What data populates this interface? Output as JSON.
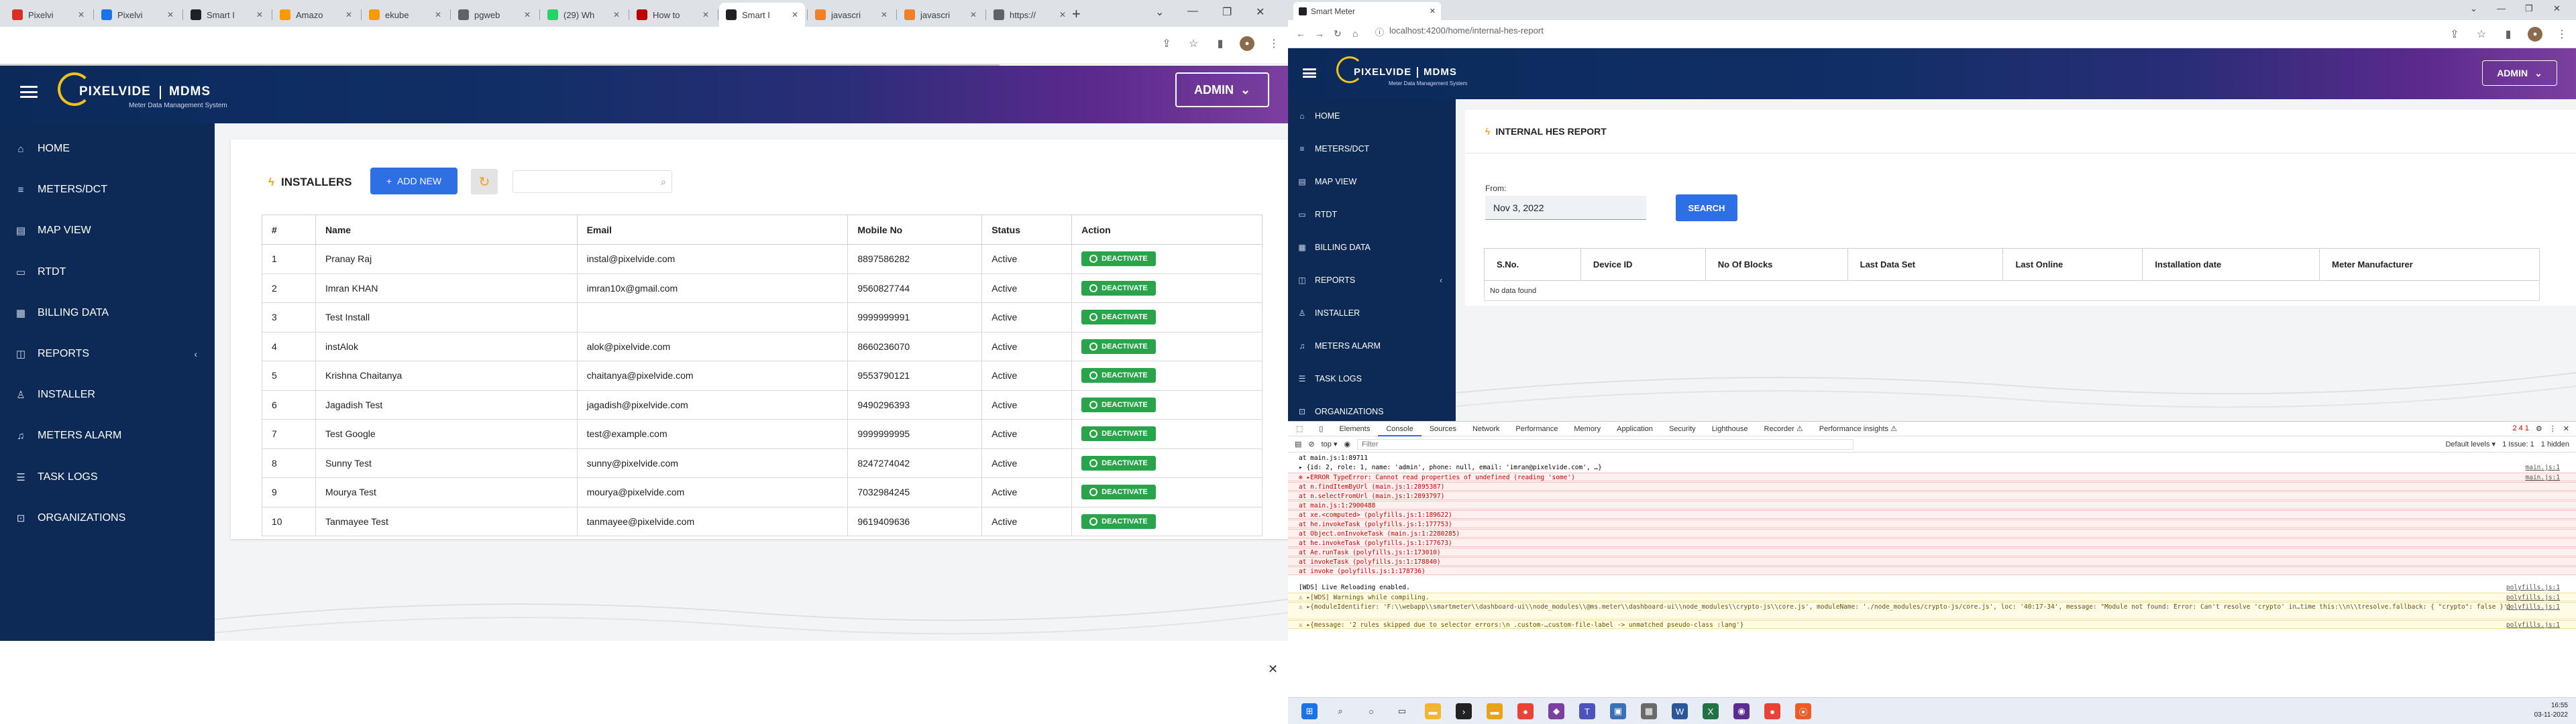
{
  "left": {
    "tabs": [
      {
        "label": "Pixelvi",
        "color": "#d93025"
      },
      {
        "label": "Pixelvi",
        "color": "#1a73e8"
      },
      {
        "label": "Smart I",
        "color": "#202124"
      },
      {
        "label": "Amazo",
        "color": "#ff9900"
      },
      {
        "label": "ekube",
        "color": "#ff9900"
      },
      {
        "label": "pgweb",
        "color": "#5f6368"
      },
      {
        "label": "(29) Wh",
        "color": "#25d366"
      },
      {
        "label": "How to",
        "color": "#c00000"
      },
      {
        "label": "Smart I",
        "color": "#202124"
      },
      {
        "label": "javascri",
        "color": "#f48024"
      },
      {
        "label": "javascri",
        "color": "#f48024"
      },
      {
        "label": "https://",
        "color": "#5f6368"
      }
    ],
    "brand": {
      "name": "PIXELVIDE",
      "product": "MDMS",
      "subtitle": "Meter Data Management System"
    },
    "admin_label": "ADMIN",
    "nav": [
      {
        "label": "HOME",
        "icon": "home-icon"
      },
      {
        "label": "METERS/DCT",
        "icon": "list-icon"
      },
      {
        "label": "MAP VIEW",
        "icon": "map-icon"
      },
      {
        "label": "RTDT",
        "icon": "document-icon"
      },
      {
        "label": "BILLING DATA",
        "icon": "grid-icon"
      },
      {
        "label": "REPORTS",
        "icon": "report-icon",
        "chevron": "‹"
      },
      {
        "label": "INSTALLER",
        "icon": "user-icon"
      },
      {
        "label": "METERS ALARM",
        "icon": "bell-icon"
      },
      {
        "label": "TASK LOGS",
        "icon": "log-icon"
      },
      {
        "label": "ORGANIZATIONS",
        "icon": "org-icon"
      }
    ],
    "page": {
      "title": "INSTALLERS",
      "add_button": "ADD NEW",
      "search_placeholder": "",
      "columns": [
        "#",
        "Name",
        "Email",
        "Mobile No",
        "Status",
        "Action"
      ],
      "rows": [
        {
          "n": "1",
          "name": "Pranay Raj",
          "email": "instal@pixelvide.com",
          "mobile": "8897586282",
          "status": "Active",
          "action": "DEACTIVATE"
        },
        {
          "n": "2",
          "name": "Imran KHAN",
          "email": "imran10x@gmail.com",
          "mobile": "9560827744",
          "status": "Active",
          "action": "DEACTIVATE"
        },
        {
          "n": "3",
          "name": "Test Install",
          "email": "",
          "mobile": "9999999991",
          "status": "Active",
          "action": "DEACTIVATE"
        },
        {
          "n": "4",
          "name": "instAlok",
          "email": "alok@pixelvide.com",
          "mobile": "8660236070",
          "status": "Active",
          "action": "DEACTIVATE"
        },
        {
          "n": "5",
          "name": "Krishna Chaitanya",
          "email": "chaitanya@pixelvide.com",
          "mobile": "9553790121",
          "status": "Active",
          "action": "DEACTIVATE"
        },
        {
          "n": "6",
          "name": "Jagadish Test",
          "email": "jagadish@pixelvide.com",
          "mobile": "9490296393",
          "status": "Active",
          "action": "DEACTIVATE"
        },
        {
          "n": "7",
          "name": "Test Google",
          "email": "test@example.com",
          "mobile": "9999999995",
          "status": "Active",
          "action": "DEACTIVATE"
        },
        {
          "n": "8",
          "name": "Sunny Test",
          "email": "sunny@pixelvide.com",
          "mobile": "8247274042",
          "status": "Active",
          "action": "DEACTIVATE"
        },
        {
          "n": "9",
          "name": "Mourya Test",
          "email": "mourya@pixelvide.com",
          "mobile": "7032984245",
          "status": "Active",
          "action": "DEACTIVATE"
        },
        {
          "n": "10",
          "name": "Tanmayee Test",
          "email": "tanmayee@pixelvide.com",
          "mobile": "9619409636",
          "status": "Active",
          "action": "DEACTIVATE"
        }
      ]
    }
  },
  "right": {
    "tab_title": "Smart Meter",
    "url": "localhost:4200/home/internal-hes-report",
    "brand": {
      "name": "PIXELVIDE",
      "product": "MDMS",
      "subtitle": "Meter Data Management System"
    },
    "admin_label": "ADMIN",
    "nav": [
      {
        "label": "HOME",
        "icon": "home-icon"
      },
      {
        "label": "METERS/DCT",
        "icon": "list-icon"
      },
      {
        "label": "MAP VIEW",
        "icon": "map-icon"
      },
      {
        "label": "RTDT",
        "icon": "document-icon"
      },
      {
        "label": "BILLING DATA",
        "icon": "grid-icon"
      },
      {
        "label": "REPORTS",
        "icon": "report-icon",
        "chevron": "‹"
      },
      {
        "label": "INSTALLER",
        "icon": "user-icon"
      },
      {
        "label": "METERS ALARM",
        "icon": "bell-icon"
      },
      {
        "label": "TASK LOGS",
        "icon": "log-icon"
      },
      {
        "label": "ORGANIZATIONS",
        "icon": "org-icon"
      }
    ],
    "page": {
      "title": "INTERNAL HES REPORT",
      "from_label": "From:",
      "from_value": "Nov 3, 2022",
      "search_button": "SEARCH",
      "columns": [
        "S.No.",
        "Device ID",
        "No Of Blocks",
        "Last Data Set",
        "Last Online",
        "Installation date",
        "Meter Manufacturer"
      ],
      "empty_text": "No data found"
    },
    "devtools": {
      "tabs": [
        "Elements",
        "Console",
        "Sources",
        "Network",
        "Performance",
        "Memory",
        "Application",
        "Security",
        "Lighthouse",
        "Recorder ⚠",
        "Performance insights ⚠"
      ],
      "context": "top",
      "filter_placeholder": "Filter",
      "levels": "Default levels ▾",
      "issues": "1 Issue: 1",
      "hidden": "1 hidden",
      "counts": "2 4 1",
      "lines": [
        {
          "type": "log",
          "text": "    at main.js:1:89711",
          "src": ""
        },
        {
          "type": "log",
          "text": "▸ {id: 2, role: 1, name: 'admin', phone: null, email: 'imran@pixelvide.com', …}",
          "src": "main.js:1"
        },
        {
          "type": "err",
          "text": "⊗ ▸ERROR TypeError: Cannot read properties of undefined (reading 'some')",
          "src": "main.js:1"
        },
        {
          "type": "err",
          "text": "      at n.findItemByUrl (main.js:1:2895387)",
          "src": ""
        },
        {
          "type": "err",
          "text": "      at n.selectFromUrl (main.js:1:2893797)",
          "src": ""
        },
        {
          "type": "err",
          "text": "      at main.js:1:2900488",
          "src": ""
        },
        {
          "type": "err",
          "text": "      at xe.<computed> (polyfills.js:1:189622)",
          "src": ""
        },
        {
          "type": "err",
          "text": "      at he.invokeTask (polyfills.js:1:177753)",
          "src": ""
        },
        {
          "type": "err",
          "text": "      at Object.onInvokeTask (main.js:1:2280285)",
          "src": ""
        },
        {
          "type": "err",
          "text": "      at he.invokeTask (polyfills.js:1:177673)",
          "src": ""
        },
        {
          "type": "err",
          "text": "      at Ae.runTask (polyfills.js:1:173010)",
          "src": ""
        },
        {
          "type": "err",
          "text": "      at invokeTask (polyfills.js:1:178840)",
          "src": ""
        },
        {
          "type": "err",
          "text": "      at invoke (polyfills.js:1:178736)",
          "src": ""
        },
        {
          "type": "log",
          "text": "[WDS] Live Reloading enabled.",
          "src": "polyfills.js:1"
        },
        {
          "type": "warn",
          "text": "⚠ ▸[WDS] Warnings while compiling.",
          "src": "polyfills.js:1"
        },
        {
          "type": "warn",
          "text": "⚠ ▸{moduleIdentifier: 'F:\\\\webapp\\\\smartmeter\\\\dashboard-ui\\\\node_modules\\\\@ms.meter\\\\dashboard-ui\\\\node_modules\\\\crypto-js\\\\core.js', moduleName: './node_modules/crypto-js/core.js', loc: '40:17-34', message: \"Module not found: Error: Can't resolve 'crypto' in…time this:\\\\n\\\\tresolve.fallback: { \"crypto\": false }'}",
          "src": "polyfills.js:1"
        },
        {
          "type": "warn",
          "text": "⚠ ▸{message: '2 rules skipped due to selector errors:\\n  .custom-…custom-file-label -> unmatched pseudo-class :lang'}",
          "src": "polyfills.js:1"
        }
      ]
    }
  },
  "taskbar": {
    "time": "16:55",
    "date": "03-11-2022",
    "apps": [
      {
        "name": "windows-icon",
        "color": "#1a73e8",
        "glyph": "⊞"
      },
      {
        "name": "search-icon",
        "color": "#444",
        "glyph": "⌕"
      },
      {
        "name": "cortana-icon",
        "color": "#444",
        "glyph": "○"
      },
      {
        "name": "task-view-icon",
        "color": "#444",
        "glyph": "▭"
      },
      {
        "name": "file-explorer-icon",
        "color": "#f2b632",
        "glyph": "▬"
      },
      {
        "name": "terminal-icon",
        "color": "#222",
        "glyph": "›"
      },
      {
        "name": "folder-icon",
        "color": "#e8a317",
        "glyph": "▬"
      },
      {
        "name": "chrome-icon",
        "color": "#ea4335",
        "glyph": "●"
      },
      {
        "name": "visual-studio-icon",
        "color": "#7b3fa0",
        "glyph": "◆"
      },
      {
        "name": "teams-icon",
        "color": "#4b53bc",
        "glyph": "T"
      },
      {
        "name": "photos-icon",
        "color": "#3b6fb6",
        "glyph": "▣"
      },
      {
        "name": "app-icon-1",
        "color": "#6a6a6a",
        "glyph": "▦"
      },
      {
        "name": "word-icon",
        "color": "#2b579a",
        "glyph": "W"
      },
      {
        "name": "excel-icon",
        "color": "#217346",
        "glyph": "X"
      },
      {
        "name": "app-icon-2",
        "color": "#5c2d91",
        "glyph": "◉"
      },
      {
        "name": "chrome-icon-2",
        "color": "#ea4335",
        "glyph": "●"
      },
      {
        "name": "postman-icon",
        "color": "#ef5b25",
        "glyph": "⦿"
      }
    ]
  }
}
